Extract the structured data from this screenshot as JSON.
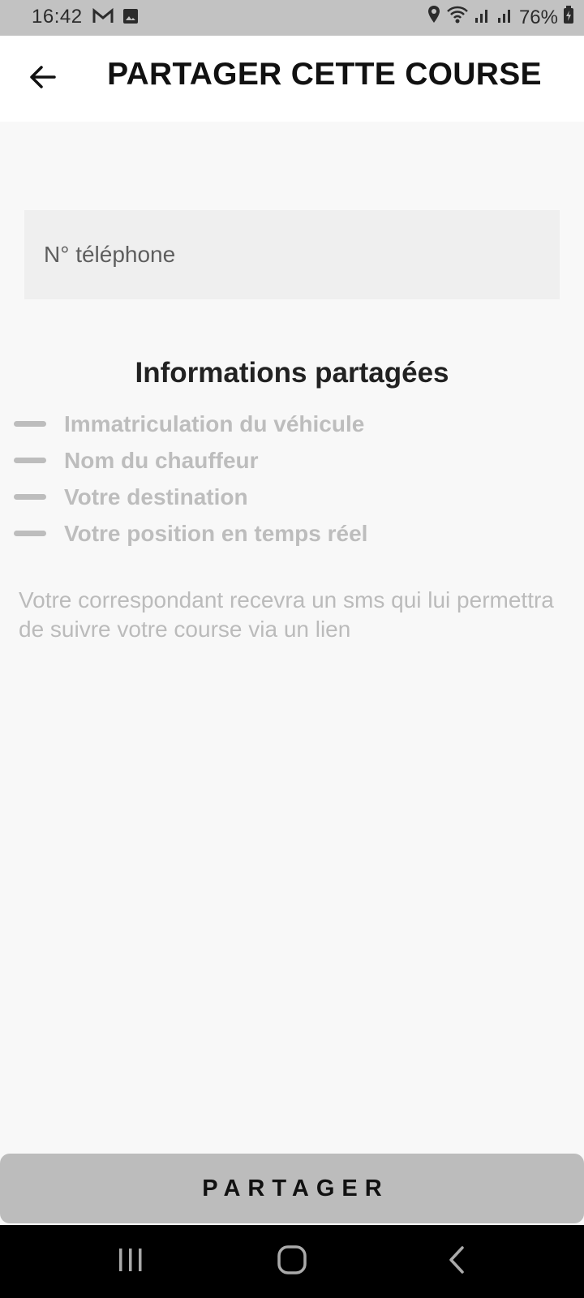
{
  "status_bar": {
    "time": "16:42",
    "notification_icons": [
      "gmail-icon",
      "gallery-icon"
    ],
    "right_icons": [
      "location-icon",
      "wifi-icon",
      "signal-icon",
      "signal-icon",
      "battery-icon"
    ],
    "battery": "76%"
  },
  "header": {
    "title": "PARTAGER CETTE COURSE",
    "back_icon": "arrow-back-icon"
  },
  "form": {
    "phone_placeholder": "N° téléphone",
    "phone_value": ""
  },
  "shared_info": {
    "heading": "Informations partagées",
    "items": [
      "Immatriculation du véhicule",
      "Nom du chauffeur",
      "Votre destination",
      "Votre position en temps réel"
    ]
  },
  "helper_text": "Votre correspondant recevra un sms qui lui permettra de suivre votre course via un lien",
  "actions": {
    "share_label": "PARTAGER"
  },
  "nav_bar": {
    "icons": [
      "recent-apps-icon",
      "home-icon",
      "back-icon"
    ]
  },
  "colors": {
    "status_bar": "#c2c2c2",
    "app_bar": "#ffffff",
    "background": "#f8f8f8",
    "input_background": "#efefef",
    "muted_text": "#bdbdbd",
    "button": "#bcbcbc",
    "nav_bar": "#000000"
  }
}
